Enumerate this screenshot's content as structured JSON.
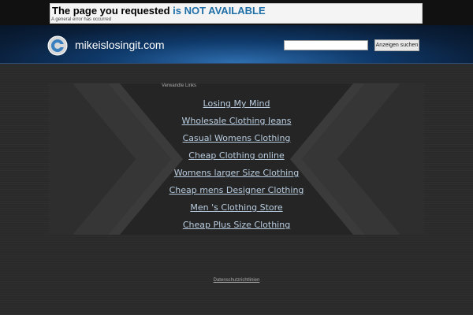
{
  "notice": {
    "title_prefix": "The page you requested ",
    "title_highlight": "is NOT AVAILABLE",
    "subtitle": "A general error has occurred"
  },
  "header": {
    "site_name": "mikeislosingit.com",
    "search": {
      "value": "",
      "placeholder": "",
      "button_label": "Anzeigen suchen"
    }
  },
  "related": {
    "label": "Verwandte Links",
    "links": [
      "Losing My Mind",
      "Wholesale Clothing Jeans",
      "Casual Womens Clothing",
      "Cheap Clothing online",
      "Womens larger Size Clothing",
      "Cheap mens Designer Clothing",
      "Men 's Clothing Store",
      "Cheap Plus Size Clothing"
    ]
  },
  "footer": {
    "privacy_label": "Datenschutzrichtlinien"
  },
  "colors": {
    "accent": "#1e6fa8",
    "link": "#b9cde0",
    "background": "#2a2a2a",
    "header": "#0f3a6b"
  },
  "icons": {
    "logo": "globe-logo-icon"
  }
}
